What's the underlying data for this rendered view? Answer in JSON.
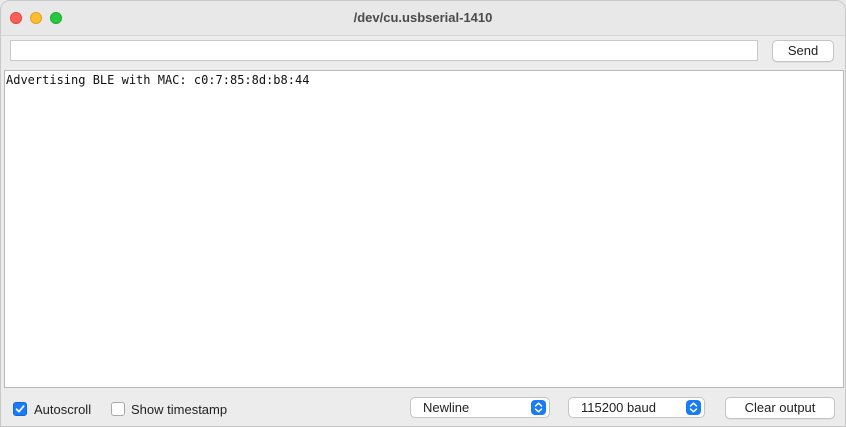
{
  "window": {
    "title": "/dev/cu.usbserial-1410"
  },
  "input": {
    "value": "",
    "placeholder": "",
    "send_label": "Send"
  },
  "output": {
    "lines": [
      "Advertising BLE with MAC: c0:7:85:8d:b8:44"
    ]
  },
  "footer": {
    "autoscroll": {
      "label": "Autoscroll",
      "checked": true
    },
    "timestamp": {
      "label": "Show timestamp",
      "checked": false
    },
    "line_ending": {
      "selected": "Newline"
    },
    "baud_rate": {
      "selected": "115200 baud"
    },
    "clear_label": "Clear output"
  },
  "icons": {
    "close": "close-icon",
    "minimize": "minimize-icon",
    "maximize": "maximize-icon",
    "checkmark": "checkmark-icon",
    "stepper": "up-down-chevron-icon"
  },
  "colors": {
    "accent": "#1a7cf4",
    "close": "#fe5f57",
    "minimize": "#febc2e",
    "maximize": "#28c840"
  }
}
